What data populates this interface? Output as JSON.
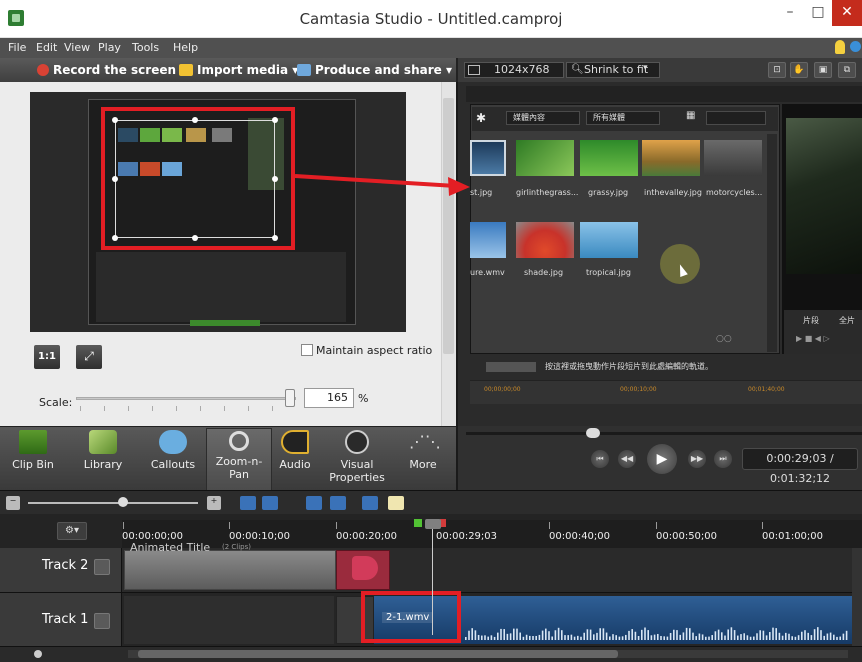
{
  "window": {
    "title": "Camtasia Studio - Untitled.camproj",
    "minimize_label": "–",
    "maximize_label": "□",
    "close_label": "✕"
  },
  "menu": [
    "File",
    "Edit",
    "View",
    "Play",
    "Tools",
    "Help"
  ],
  "toolbar": {
    "record_label": "Record the screen ▾",
    "import_label": "Import media ▾",
    "produce_label": "Produce and share ▾"
  },
  "preview_toolbar": {
    "resolution": "1024x768",
    "zoom_mode": "Shrink to fit"
  },
  "zoom_panel": {
    "one_to_one_label": "1:1",
    "fit_label": "⤢",
    "maintain_aspect_label": "Maintain aspect ratio",
    "maintain_aspect_checked": false,
    "scale_label": "Scale:",
    "scale_value": "165",
    "scale_unit": "%",
    "scale_level": 0.9
  },
  "preview_content": {
    "dropdown1": "媒體內容",
    "dropdown2": "所有媒體",
    "thumbnails_row1": [
      "st.jpg",
      "girlinthegrass...",
      "grassy.jpg",
      "inthevalley.jpg",
      "motorcycles..."
    ],
    "thumbnails_row2": [
      "ure.wmv",
      "shade.jpg",
      "tropical.jpg"
    ],
    "footer_text": "按這裡或拖曳動作片段短片到此處編輯的軌道。",
    "times": [
      "00;00;00;00",
      "00;00;10;00",
      "00;01;40;00"
    ],
    "right_label1": "片段",
    "right_label2": "全片"
  },
  "tabs": [
    {
      "label": "Clip Bin",
      "icon": "film-icon"
    },
    {
      "label": "Library",
      "icon": "library-icon"
    },
    {
      "label": "Callouts",
      "icon": "callout-icon"
    },
    {
      "label": "Zoom-n-Pan",
      "icon": "magnifier-icon"
    },
    {
      "label": "Audio",
      "icon": "speaker-icon"
    },
    {
      "label": "Visual Properties",
      "icon": "visual-properties-icon"
    },
    {
      "label": "More",
      "icon": "more-icon"
    }
  ],
  "playback": {
    "time": "0:00:29;03 / 0:01:32;12",
    "prev_label": "⏮",
    "rew_label": "◀◀",
    "play_label": "▶",
    "ff_label": "▶▶",
    "next_label": "⏭"
  },
  "timeline": {
    "ruler_labels": [
      "00:00:00;00",
      "00:00:10;00",
      "00:00:20;00",
      "00:00:29;03",
      "00:00:40;00",
      "00:00:50;00",
      "00:01:00;00"
    ],
    "gear_label": "⚙▾",
    "tracks": [
      {
        "name": "Track 2",
        "clip_title": "Animated Title",
        "clip_sub": "(2 Clips)"
      },
      {
        "name": "Track 1",
        "clip_label": "2-1.wmv"
      }
    ]
  },
  "colors": {
    "annotation_red": "#e31e24",
    "audio_clip": "#2f5f96",
    "close_button": "#c42b1c"
  }
}
